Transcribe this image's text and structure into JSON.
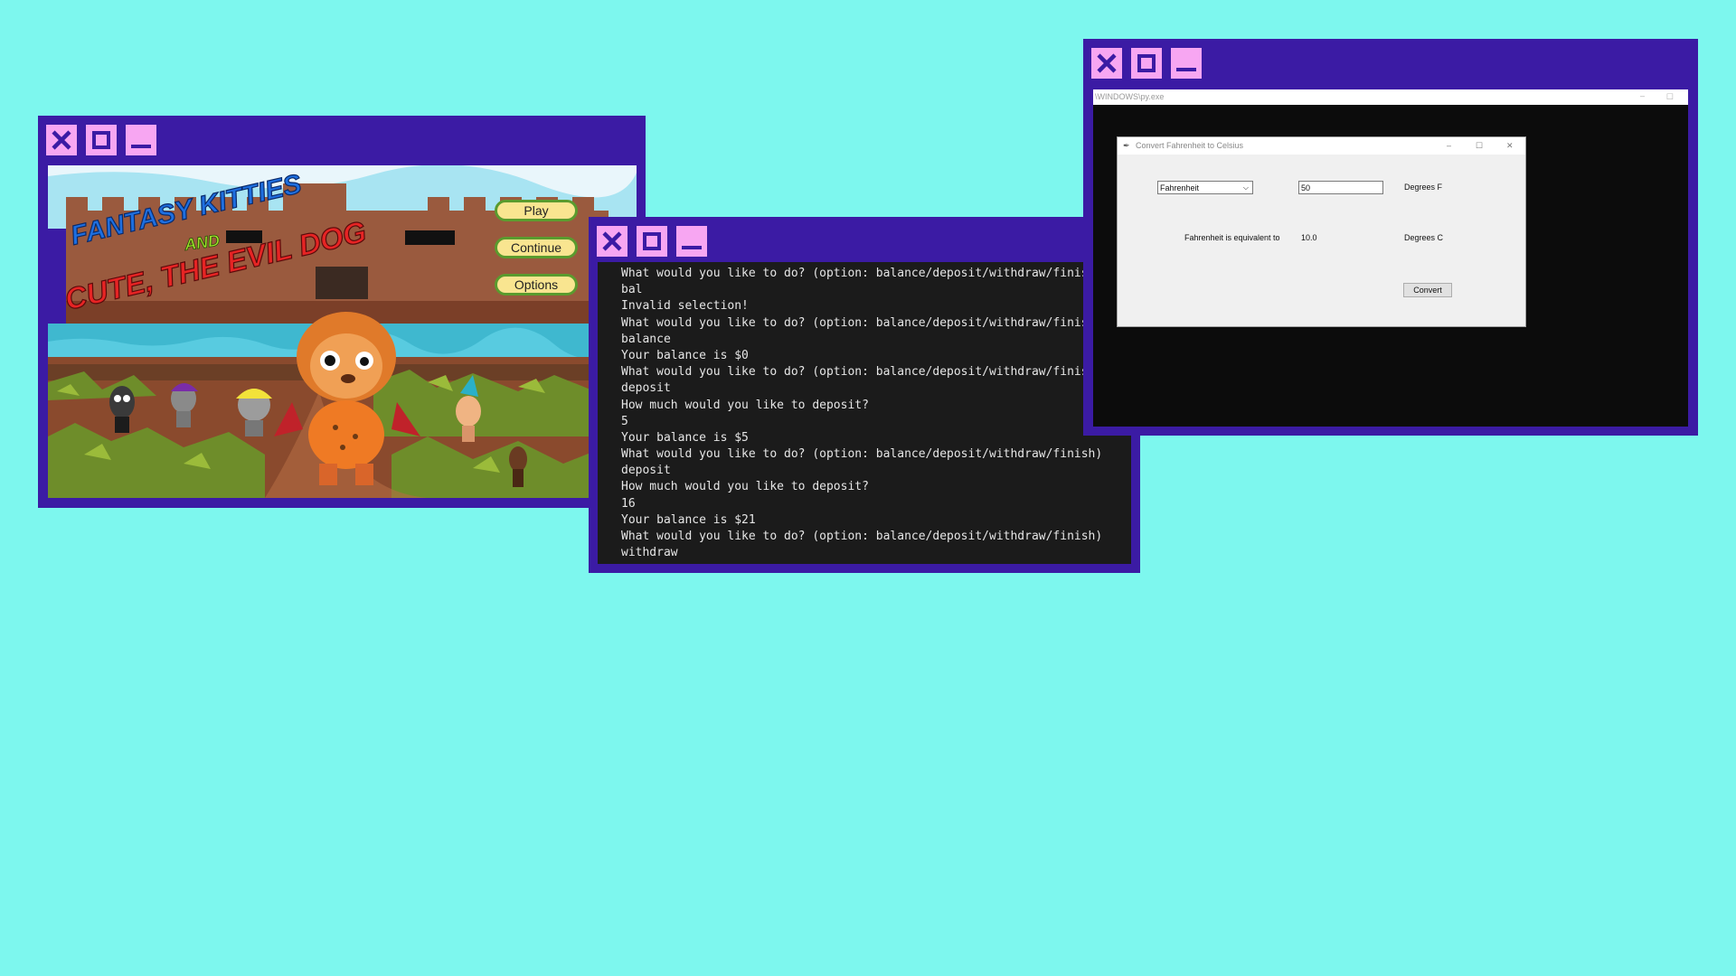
{
  "colors": {
    "background": "#7df7ee",
    "window_frame": "#3b1ba4",
    "control_button": "#f7a6f2",
    "console_bg": "#1b1b1b"
  },
  "window_controls": [
    "close-icon",
    "maximize-icon",
    "minimize-icon"
  ],
  "game": {
    "title_line1": "FANTASY KITTIES",
    "title_and": "AND",
    "title_line2": "CUTE, THE EVIL DOG",
    "buttons": [
      "Play",
      "Continue",
      "Options"
    ]
  },
  "console": {
    "lines": [
      "What would you like to do? (option: balance/deposit/withdraw/finish)",
      "bal",
      "Invalid selection!",
      "What would you like to do? (option: balance/deposit/withdraw/finish)",
      "balance",
      "Your balance is $0",
      "What would you like to do? (option: balance/deposit/withdraw/finish)",
      "deposit",
      "How much would you like to deposit?",
      "5",
      "Your balance is $5",
      "What would you like to do? (option: balance/deposit/withdraw/finish)",
      "deposit",
      "How much would you like to deposit?",
      "16",
      "Your balance is $21",
      "What would you like to do? (option: balance/deposit/withdraw/finish)",
      "withdraw"
    ]
  },
  "converter": {
    "host_title": "\\WINDOWS\\py.exe",
    "dialog_title": "Convert Fahrenheit to Celsius",
    "unit_select": "Fahrenheit",
    "input_value": "50",
    "input_unit": "Degrees F",
    "equiv_label": "Fahrenheit is equivalent to",
    "result_value": "10.0",
    "result_unit": "Degrees C",
    "convert_button": "Convert"
  }
}
